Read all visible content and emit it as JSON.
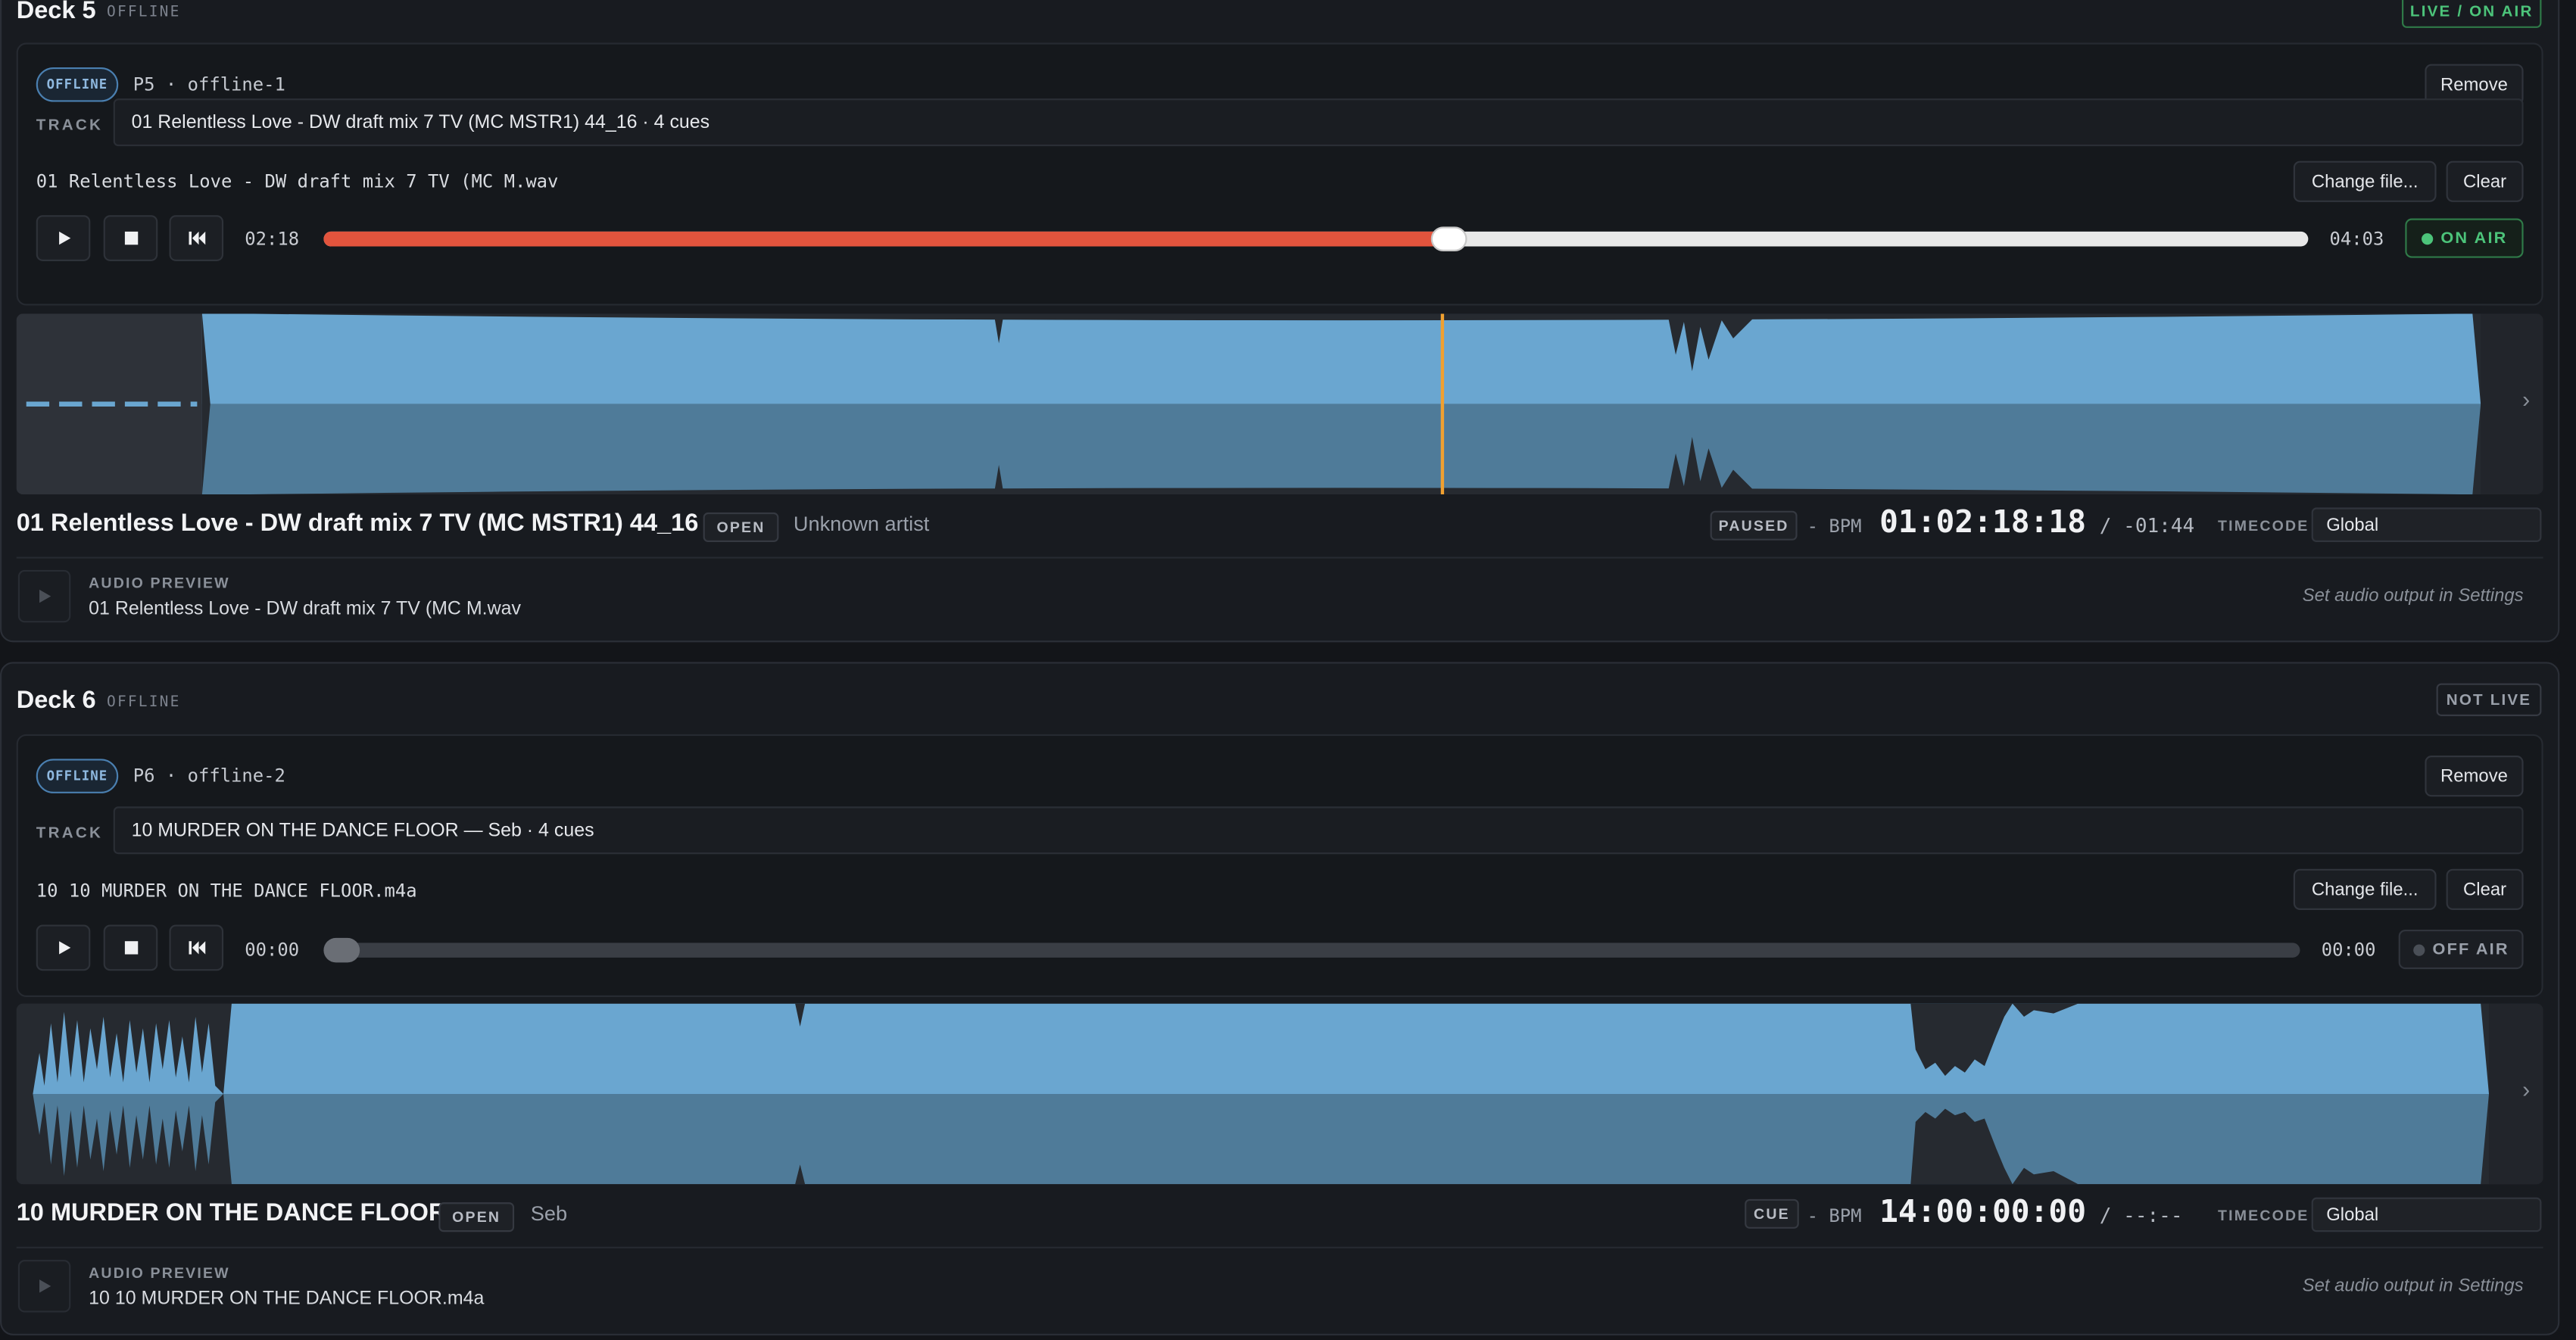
{
  "colors": {
    "accent_live": "#4cc47a",
    "progress": "#e2543d",
    "waveform": "#6aa6d0",
    "pill_offline": "#8fb9e0",
    "playhead": "#f0a030"
  },
  "decks": [
    {
      "title": "Deck 5",
      "status": "OFFLINE",
      "live_badge": "LIVE / ON AIR",
      "pill": "OFFLINE",
      "player_id": "P5 · offline-1",
      "remove_label": "Remove",
      "track_label": "TRACK",
      "track_value": "01 Relentless Love - DW draft mix 7 TV (MC MSTR1) 44_16 · 4 cues",
      "filename": "01 Relentless Love - DW draft mix 7 TV (MC M.wav",
      "change_label": "Change file...",
      "clear_label": "Clear",
      "time_current": "02:18",
      "time_total": "04:03",
      "progress": 0.567,
      "air_label": "ON AIR",
      "air_state": "on",
      "info_title": "01 Relentless Love - DW draft mix 7 TV (MC MSTR1) 44_16",
      "open_label": "OPEN",
      "artist": "Unknown artist",
      "state_badge": "PAUSED",
      "bpm": "- BPM",
      "timecode": "01:02:18:18",
      "remaining": "/ -01:44",
      "timecode_label": "TIMECODE",
      "timecode_source": "Global",
      "preview_label": "AUDIO PREVIEW",
      "preview_file": "01 Relentless Love - DW draft mix 7 TV (MC M.wav",
      "preview_hint": "Set audio output in Settings",
      "icons": {
        "play": "play-icon",
        "stop": "stop-icon",
        "rewind": "skip-back-icon",
        "chevron": "chevron-right-icon"
      }
    },
    {
      "title": "Deck 6",
      "status": "OFFLINE",
      "live_badge": "NOT LIVE",
      "pill": "OFFLINE",
      "player_id": "P6 · offline-2",
      "remove_label": "Remove",
      "track_label": "TRACK",
      "track_value": "10 MURDER ON THE DANCE FLOOR — Seb · 4 cues",
      "filename": "10 10 MURDER ON THE DANCE FLOOR.m4a",
      "change_label": "Change file...",
      "clear_label": "Clear",
      "time_current": "00:00",
      "time_total": "00:00",
      "progress": 0.0,
      "air_label": "OFF AIR",
      "air_state": "off",
      "info_title": "10 MURDER ON THE DANCE FLOOR",
      "open_label": "OPEN",
      "artist": "Seb",
      "state_badge": "CUE",
      "bpm": "- BPM",
      "timecode": "14:00:00:00",
      "remaining": "/ --:--",
      "timecode_label": "TIMECODE",
      "timecode_source": "Global",
      "preview_label": "AUDIO PREVIEW",
      "preview_file": "10 10 MURDER ON THE DANCE FLOOR.m4a",
      "preview_hint": "Set audio output in Settings",
      "icons": {
        "play": "play-icon",
        "stop": "stop-icon",
        "rewind": "skip-back-icon",
        "chevron": "chevron-right-icon"
      }
    }
  ]
}
